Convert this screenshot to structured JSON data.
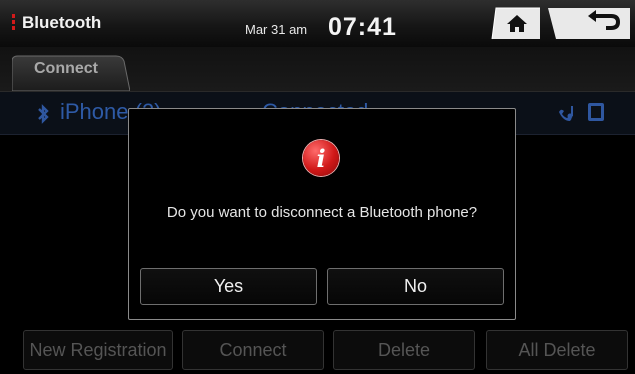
{
  "header": {
    "title": "Bluetooth",
    "date": "Mar 31 am",
    "time": "07:41",
    "home_icon": "home-icon",
    "back_icon": "back-arrow-icon"
  },
  "tabs": [
    {
      "label": "Connect",
      "active": true
    }
  ],
  "device": {
    "name": "iPhone (2)",
    "status": "Connected",
    "icons": [
      "bluetooth-icon",
      "music-phone-icon",
      "phone-square-icon"
    ]
  },
  "bottom_buttons": [
    {
      "label": "New Registration"
    },
    {
      "label": "Connect"
    },
    {
      "label": "Delete"
    },
    {
      "label": "All Delete"
    }
  ],
  "dialog": {
    "icon": "info-icon",
    "icon_glyph": "i",
    "message": "Do you want to disconnect a Bluetooth phone?",
    "yes_label": "Yes",
    "no_label": "No"
  },
  "colors": {
    "accent_red": "#d21a1a",
    "device_blue": "#2e5aa6",
    "background": "#000000"
  }
}
